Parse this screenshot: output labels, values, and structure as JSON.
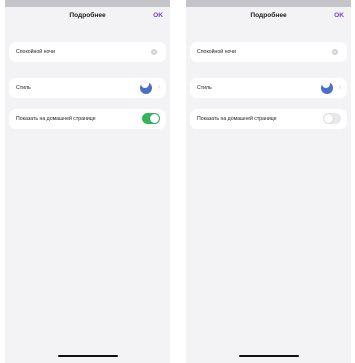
{
  "screens": [
    {
      "header": {
        "title": "Подробнее",
        "ok_label": "OK"
      },
      "rows": [
        {
          "label": "Спокойной ночи"
        },
        {
          "label": "Стиль"
        },
        {
          "label": "Показать на домашней странице",
          "toggle_on": true
        }
      ]
    },
    {
      "header": {
        "title": "Подробнее",
        "ok_label": "OK"
      },
      "rows": [
        {
          "label": "Спокойной ночи"
        },
        {
          "label": "Стиль"
        },
        {
          "label": "Показать на домашней странице",
          "toggle_on": false
        }
      ]
    }
  ],
  "colors": {
    "accent": "#7b3fb8",
    "toggle_on": "#34b55a",
    "moon": "#4a6fc8",
    "background": "#f3f3f6"
  },
  "icons": [
    "radio-dot-icon",
    "moon-icon",
    "chevron-right-icon",
    "toggle-switch"
  ]
}
